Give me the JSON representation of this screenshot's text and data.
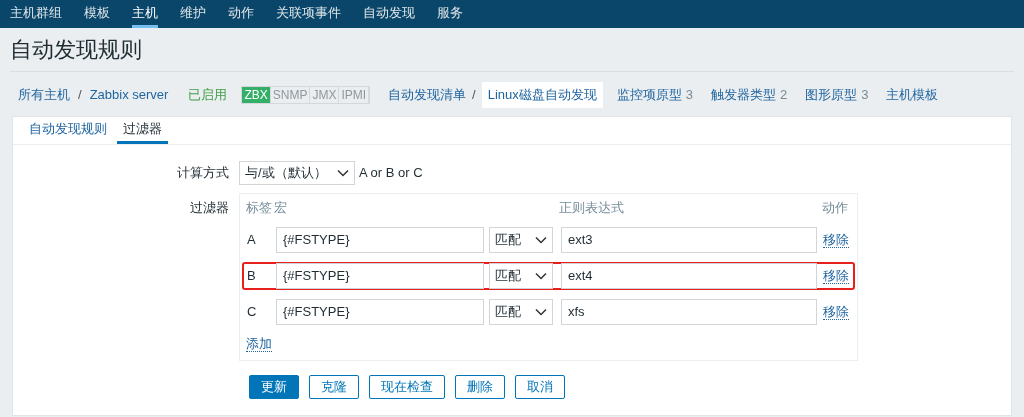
{
  "nav": [
    {
      "label": "主机群组",
      "selected": false
    },
    {
      "label": "模板",
      "selected": false
    },
    {
      "label": "主机",
      "selected": true
    },
    {
      "label": "维护",
      "selected": false
    },
    {
      "label": "动作",
      "selected": false
    },
    {
      "label": "关联项事件",
      "selected": false
    },
    {
      "label": "自动发现",
      "selected": false
    },
    {
      "label": "服务",
      "selected": false
    }
  ],
  "title": "自动发现规则",
  "breadcrumb": {
    "separator": "/",
    "host_path": [
      "所有主机",
      "Zabbix server"
    ],
    "status": "已启用",
    "badges": [
      {
        "label": "ZBX",
        "on": true
      },
      {
        "label": "SNMP",
        "on": false
      },
      {
        "label": "JMX",
        "on": false
      },
      {
        "label": "IPMI",
        "on": false
      }
    ],
    "rule_path": [
      "自动发现清单",
      "Linux磁盘自动发现"
    ],
    "links": [
      {
        "label": "监控项原型",
        "count": "3"
      },
      {
        "label": "触发器类型",
        "count": "2"
      },
      {
        "label": "图形原型",
        "count": "3"
      },
      {
        "label": "主机模板"
      }
    ]
  },
  "tabs": [
    {
      "label": "自动发现规则",
      "selected": false
    },
    {
      "label": "过滤器",
      "selected": true
    }
  ],
  "calculation": {
    "label": "计算方式",
    "value": "与/或（默认）",
    "expression": "A or B or C"
  },
  "filter": {
    "label": "过滤器",
    "headers": [
      "标签",
      "宏",
      "正则表达式",
      "动作"
    ],
    "rows": [
      {
        "label": "A",
        "macro": "{#FSTYPE}",
        "operator": "匹配",
        "regex": "ext3",
        "action": "移除",
        "highlighted": false
      },
      {
        "label": "B",
        "macro": "{#FSTYPE}",
        "operator": "匹配",
        "regex": "ext4",
        "action": "移除",
        "highlighted": true
      },
      {
        "label": "C",
        "macro": "{#FSTYPE}",
        "operator": "匹配",
        "regex": "xfs",
        "action": "移除",
        "highlighted": false
      }
    ],
    "add": "添加"
  },
  "buttons": [
    {
      "label": "更新",
      "primary": true
    },
    {
      "label": "克隆",
      "primary": false
    },
    {
      "label": "现在检查",
      "primary": false
    },
    {
      "label": "删除",
      "primary": false
    },
    {
      "label": "取消",
      "primary": false
    }
  ]
}
